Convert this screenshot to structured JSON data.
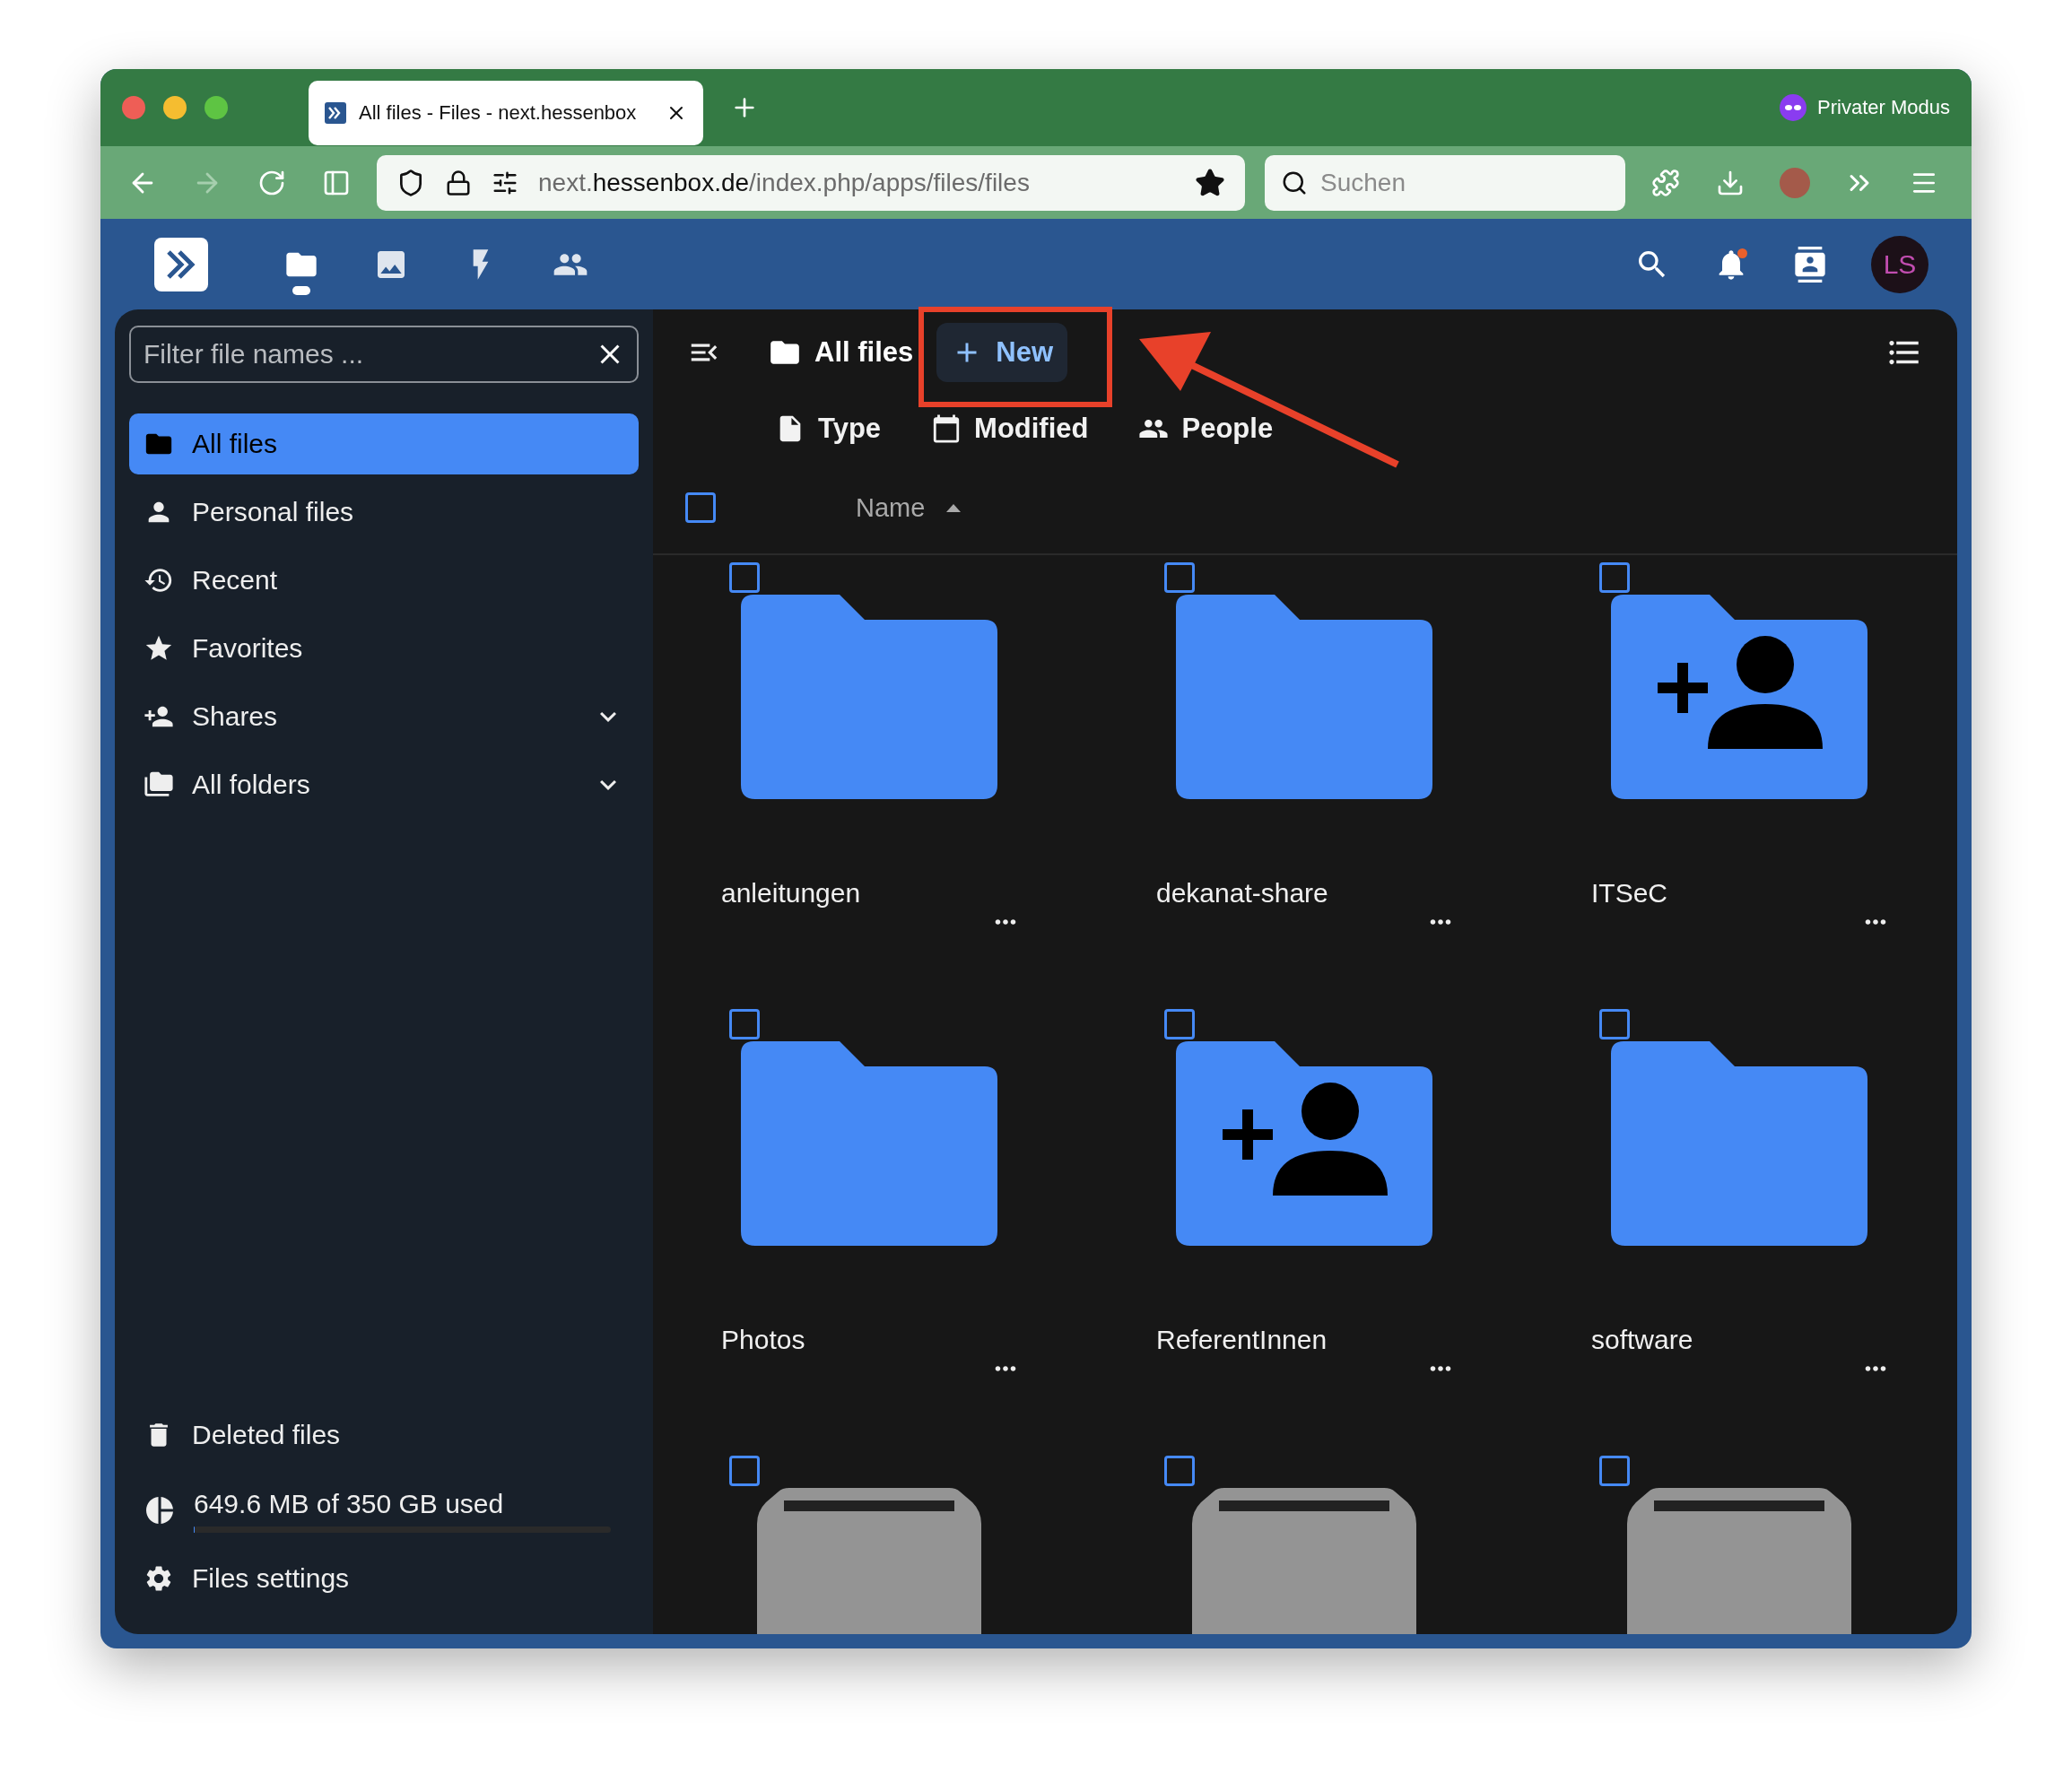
{
  "browser": {
    "tabs": [
      {
        "title": "All files - Files - next.hessenbox",
        "selected": true
      }
    ],
    "private_mode": "Privater Modus",
    "url": {
      "subdomain": "next.",
      "domain": "hessenbox.de",
      "path": "/index.php/apps/files/files"
    },
    "search": {
      "placeholder": "Suchen"
    }
  },
  "header": {
    "apps": [
      {
        "kind": "files",
        "selected": true
      },
      {
        "kind": "photos",
        "selected": false
      },
      {
        "kind": "activity",
        "selected": false
      },
      {
        "kind": "contacts",
        "selected": false
      }
    ],
    "notifications_unread": true,
    "avatar": "LS"
  },
  "sidebar": {
    "filter": {
      "placeholder": "Filter file names ..."
    },
    "items": [
      {
        "kind": "folder",
        "label": "All files",
        "selected": true,
        "expandable": false
      },
      {
        "kind": "person",
        "label": "Personal files",
        "selected": false,
        "expandable": false
      },
      {
        "kind": "recent",
        "label": "Recent",
        "selected": false,
        "expandable": false
      },
      {
        "kind": "star",
        "label": "Favorites",
        "selected": false,
        "expandable": false
      },
      {
        "kind": "share",
        "label": "Shares",
        "selected": false,
        "expandable": true
      },
      {
        "kind": "folders",
        "label": "All folders",
        "selected": false,
        "expandable": true
      }
    ],
    "deleted": "Deleted files",
    "storage": {
      "label": "649.6 MB of 350 GB used",
      "level": 0.002
    },
    "settings": "Files settings"
  },
  "main": {
    "breadcrumb": "All files",
    "new_button": "New",
    "filters": [
      {
        "kind": "type",
        "label": "Type"
      },
      {
        "kind": "modified",
        "label": "Modified"
      },
      {
        "kind": "people",
        "label": "People"
      }
    ],
    "column": {
      "label": "Name"
    },
    "select_all": false,
    "items": [
      {
        "kind": "folder",
        "name": "anleitungen",
        "selected": false
      },
      {
        "kind": "folder",
        "name": "dekanat-share",
        "selected": false
      },
      {
        "kind": "shared",
        "name": "ITSeC",
        "selected": false
      },
      {
        "kind": "folder",
        "name": "Photos",
        "selected": false
      },
      {
        "kind": "shared",
        "name": "ReferentInnen",
        "selected": false
      },
      {
        "kind": "folder",
        "name": "software",
        "selected": false
      },
      {
        "kind": "drive",
        "selected": false
      },
      {
        "kind": "drive",
        "selected": false
      },
      {
        "kind": "drive",
        "selected": false
      }
    ]
  }
}
